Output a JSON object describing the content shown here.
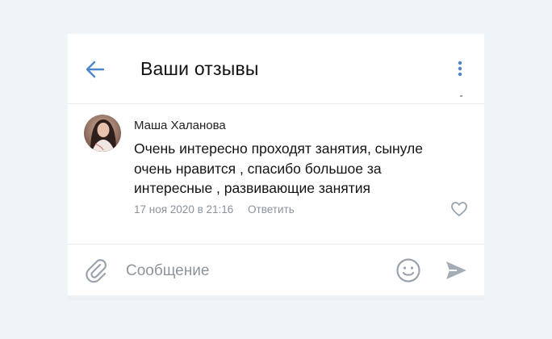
{
  "header": {
    "title": "Ваши отзывы",
    "back_icon": "arrow-left-icon",
    "more_icon": "more-vertical-icon"
  },
  "comment": {
    "author": "Маша Халанова",
    "text": "Очень интересно проходят занятия, сынуле очень нравится , спасибо большое за интересные , развивающие занятия",
    "date": "17 ноя 2020 в 21:16",
    "reply_label": "Ответить",
    "like_icon": "heart-icon"
  },
  "composer": {
    "placeholder": "Сообщение",
    "attach_icon": "paperclip-icon",
    "emoji_icon": "smile-icon",
    "send_icon": "send-icon"
  },
  "colors": {
    "accent": "#4a86c8",
    "icon_gray": "#9aa3ad",
    "background": "#eef4f8"
  }
}
